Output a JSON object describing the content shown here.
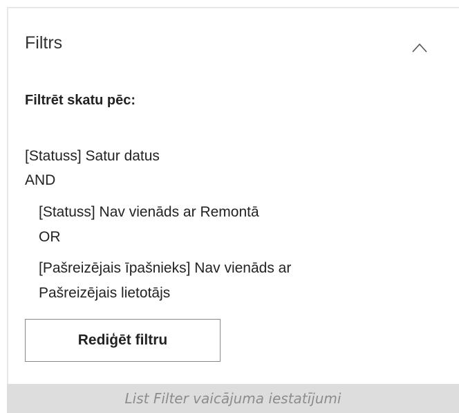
{
  "panel": {
    "title": "Filtrs",
    "collapse_icon": "chevron-up-icon",
    "filter_heading": "Filtrēt skatu pēc:",
    "filter_lines": [
      "[Statuss] Satur datus",
      "AND",
      "[Statuss] Nav vienāds ar Remontā",
      "OR",
      "[Pašreizējais īpašnieks] Nav vienāds ar",
      "Pašreizējais lietotājs"
    ],
    "edit_button_label": "Rediģēt filtru"
  },
  "caption": "List Filter vaicājuma iestatījumi",
  "colors": {
    "text": "#222222",
    "border": "#8a8886",
    "caption_bg": "#dddddd",
    "caption_text": "#8c8c8c"
  }
}
